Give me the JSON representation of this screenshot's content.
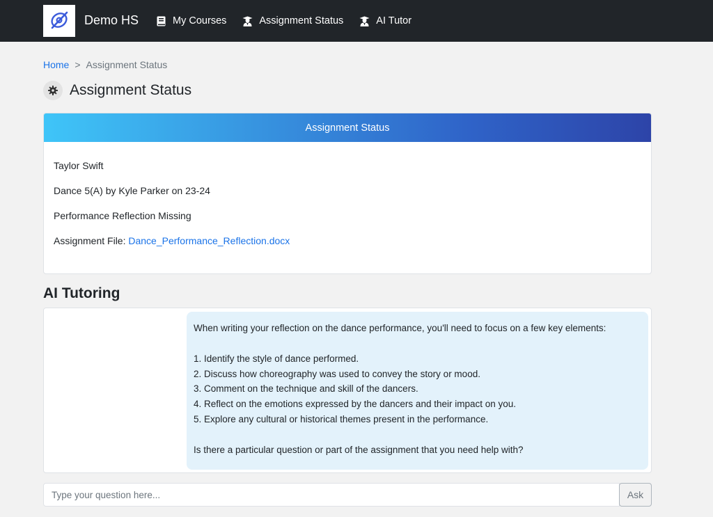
{
  "navbar": {
    "brand_name": "Demo HS",
    "logo_icon": "slashed-eye-logo",
    "items": [
      {
        "label": "My Courses",
        "icon": "book-icon"
      },
      {
        "label": "Assignment Status",
        "icon": "user-graduate-icon"
      },
      {
        "label": "AI Tutor",
        "icon": "user-graduate-icon"
      }
    ]
  },
  "breadcrumb": {
    "home": "Home",
    "separator": ">",
    "current": "Assignment Status"
  },
  "page": {
    "title": "Assignment Status",
    "title_icon": "gear-icon"
  },
  "status_card": {
    "header": "Assignment Status",
    "student_name": "Taylor Swift",
    "course": "Dance 5(A) by Kyle Parker on 23-24",
    "status": "Performance Reflection Missing",
    "file_label": "Assignment File:",
    "file_name": "Dance_Performance_Reflection.docx"
  },
  "tutoring": {
    "title": "AI Tutoring",
    "message": {
      "intro": "When writing your reflection on the dance performance, you'll need to focus on a few key elements:",
      "points": [
        "1. Identify the style of dance performed.",
        "2. Discuss how choreography was used to convey the story or mood.",
        "3. Comment on the technique and skill of the dancers.",
        "4. Reflect on the emotions expressed by the dancers and their impact on you.",
        "5. Explore any cultural or historical themes present in the performance."
      ],
      "closing": "Is there a particular question or part of the assignment that you need help with?"
    }
  },
  "ask": {
    "placeholder": "Type your question here...",
    "value": "",
    "button_label": "Ask"
  },
  "colors": {
    "navbar_bg": "#212529",
    "link": "#1a73e8",
    "header_gradient_start": "#3fc5f8",
    "header_gradient_end": "#2d44a8",
    "bubble_bg": "#e3f2fb",
    "logo_accent": "#3b5bdb"
  }
}
